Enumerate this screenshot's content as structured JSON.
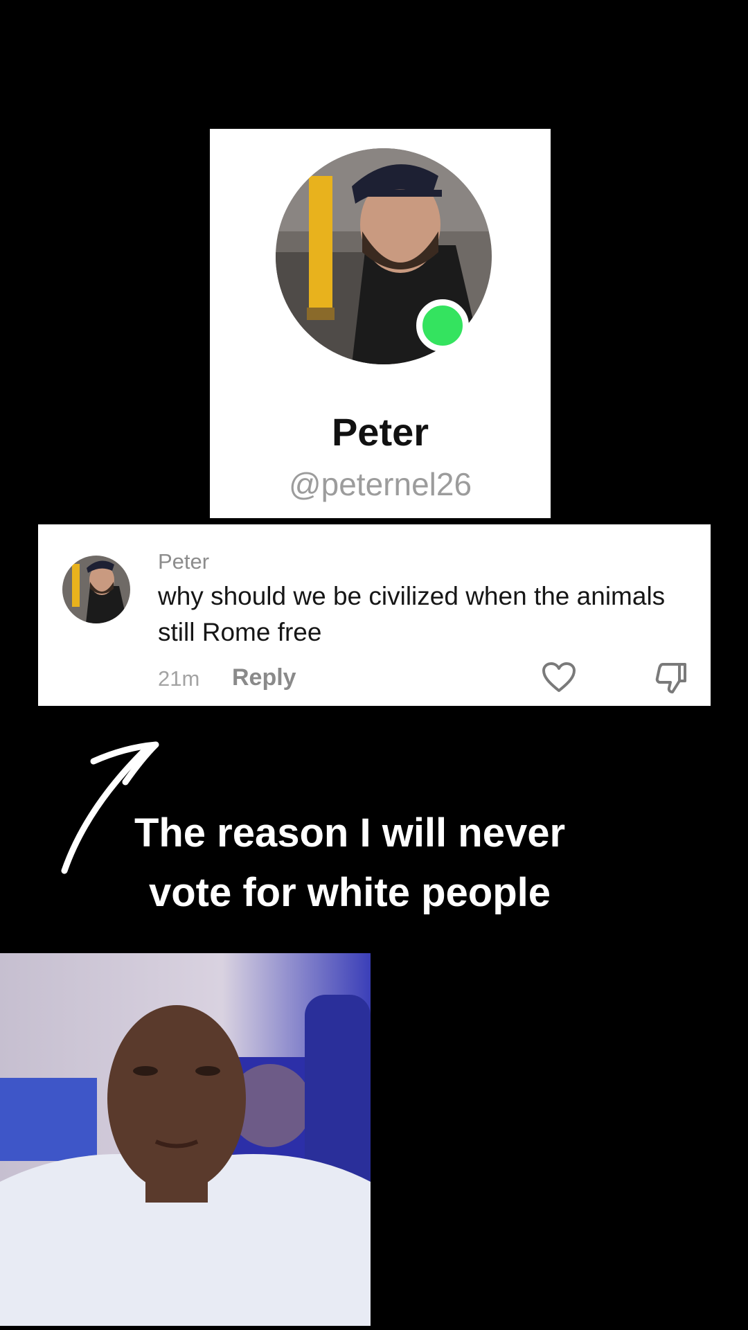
{
  "profile": {
    "name": "Peter",
    "handle": "@peternel26",
    "online_color": "#34e35f",
    "avatar": "profile-photo-avatar"
  },
  "comment": {
    "author": "Peter",
    "text": "why should we be civilized when the animals still Rome free",
    "time": "21m",
    "reply_label": "Reply",
    "like_icon": "heart-outline-icon",
    "dislike_icon": "thumbs-down-outline-icon"
  },
  "overlay": {
    "arrow_icon": "curved-arrow-icon",
    "caption": "The reason I will never vote for white people"
  },
  "video": {
    "description_icon": "selfie-video-inset"
  }
}
